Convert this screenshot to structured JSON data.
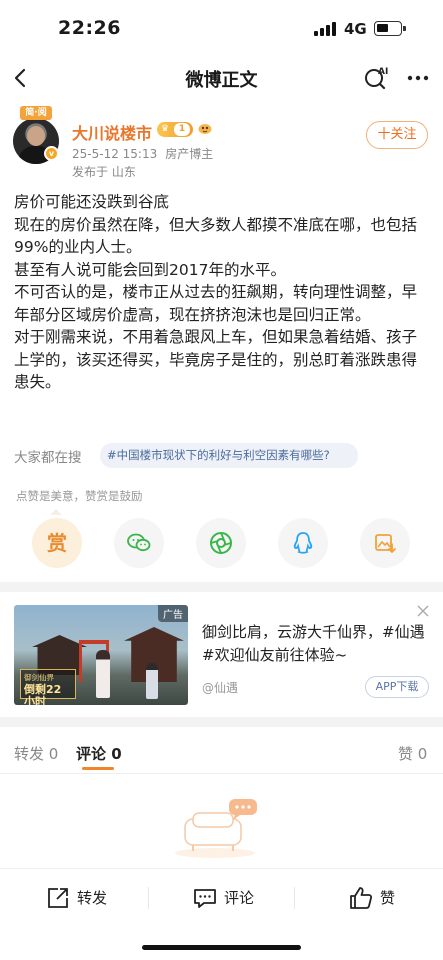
{
  "status_bar": {
    "time": "22:26",
    "network": "4G"
  },
  "nav": {
    "title": "微博正文",
    "ai_label": "AI"
  },
  "author": {
    "avatar_badge": "简·阅",
    "name": "大川说楼市",
    "level": "1",
    "date": "25-5-12 15:13",
    "title": "房产博主",
    "location": "发布于 山东",
    "follow_label": "十关注"
  },
  "post": {
    "paragraphs": [
      "房价可能还没跌到谷底",
      "现在的房价虽然在降，但大多数人都摸不准底在哪，也包括99%的业内人士。",
      "甚至有人说可能会回到2017年的水平。",
      "不可否认的是，楼市正从过去的狂飙期，转向理性调整，早年部分区域房价虚高，现在挤挤泡沫也是回归正常。",
      "对于刚需来说，不用着急跟风上车，但如果急着结婚、孩子上学的，该买还得买，毕竟房子是住的，别总盯着涨跌患得患失。"
    ]
  },
  "search": {
    "label": "大家都在搜",
    "topic": "#中国楼市现状下的利好与利空因素有哪些?"
  },
  "reward": {
    "hint": "点赞是美意，赞赏是鼓励",
    "reward_label": "赏",
    "share_targets": [
      "wechat-icon",
      "moments-icon",
      "qq-icon",
      "save-image-icon"
    ]
  },
  "ad": {
    "tag": "广告",
    "banner_line1": "御剑仙界",
    "banner_line2": "倒剩22小时",
    "text": "御剑比肩，云游大千仙界，#仙遇#欢迎仙友前往体验~",
    "source": "@仙遇",
    "button": "APP下载"
  },
  "tabs": [
    {
      "label": "转发",
      "count": "0"
    },
    {
      "label": "评论",
      "count": "0"
    },
    {
      "label": "赞",
      "count": "0"
    }
  ],
  "bottom_bar": {
    "repost": "转发",
    "comment": "评论",
    "like": "赞"
  },
  "colors": {
    "accent": "#f0862a",
    "author_name": "#e8772e",
    "topic": "#4a6b9e"
  }
}
